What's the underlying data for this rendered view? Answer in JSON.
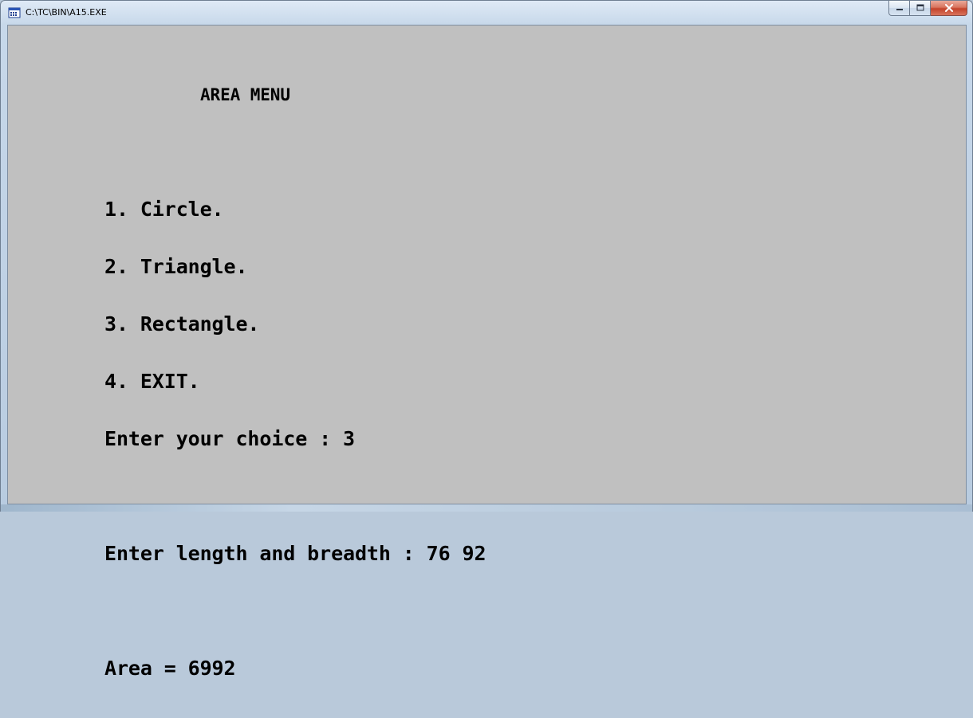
{
  "window": {
    "title": "C:\\TC\\BIN\\A15.EXE",
    "icon": "dos-program-icon",
    "controls": {
      "minimize_icon": "minimize-icon",
      "maximize_icon": "maximize-icon",
      "close_icon": "close-icon"
    }
  },
  "console": {
    "heading": "AREA MENU",
    "menu_items": [
      "1. Circle.",
      "2. Triangle.",
      "3. Rectangle.",
      "4. EXIT."
    ],
    "choice_prompt": "Enter your choice : 3",
    "dimensions_prompt": "Enter length and breadth : 76 92",
    "result": "Area = 6992"
  },
  "colors": {
    "console_background": "#c0c0c0",
    "console_text": "#000000"
  }
}
